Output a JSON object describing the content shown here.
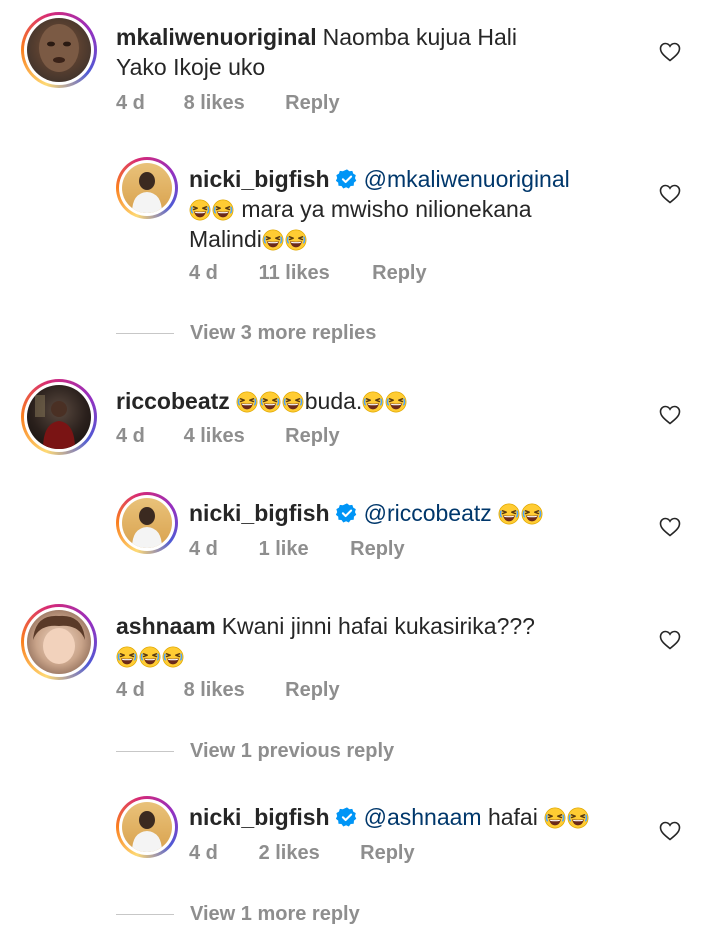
{
  "emoji_icon": "grinning-squinting-face-emoji",
  "verified_color": "#0095f6",
  "mention_color": "#00376b",
  "comments": [
    {
      "username": "mkaliwenuoriginal",
      "text_line1": "Naomba kujua Hali",
      "text_line2": "Yako Ikoje uko",
      "time": "4 d",
      "likes": "8 likes",
      "reply": "Reply"
    },
    {
      "username": "nicki_bigfish",
      "mention": "@mkaliwenuoriginal",
      "text_line2": "mara ya mwisho nilionekana",
      "text_line3": "Malindi",
      "time": "4 d",
      "likes": "11 likes",
      "reply": "Reply"
    },
    {
      "view_more": "View 3 more replies"
    },
    {
      "username": "riccobeatz",
      "text": "buda.",
      "time": "4 d",
      "likes": "4 likes",
      "reply": "Reply"
    },
    {
      "username": "nicki_bigfish",
      "mention": "@riccobeatz",
      "time": "4 d",
      "likes": "1 like",
      "reply": "Reply"
    },
    {
      "username": "ashnaam",
      "text_line1": "Kwani jinni hafai kukasirika???",
      "time": "4 d",
      "likes": "8 likes",
      "reply": "Reply"
    },
    {
      "view_more": "View 1 previous reply"
    },
    {
      "username": "nicki_bigfish",
      "mention": "@ashnaam",
      "text": "hafai",
      "time": "4 d",
      "likes": "2 likes",
      "reply": "Reply"
    },
    {
      "view_more": "View 1 more reply"
    }
  ]
}
